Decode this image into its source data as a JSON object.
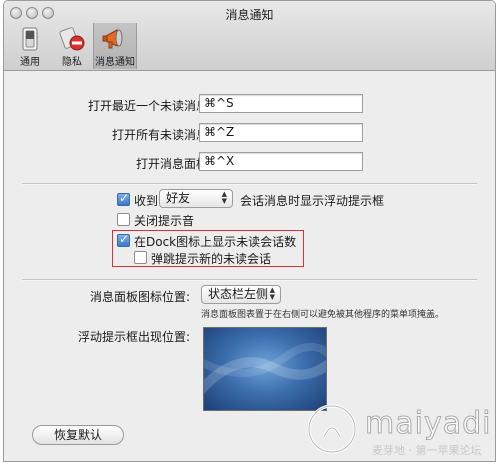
{
  "window": {
    "title": "消息通知"
  },
  "toolbar": {
    "items": [
      {
        "label": "通用",
        "icon": "switch-icon"
      },
      {
        "label": "隐私",
        "icon": "no-entry-icon"
      },
      {
        "label": "消息通知",
        "icon": "megaphone-icon",
        "selected": true
      }
    ]
  },
  "shortcuts": {
    "open_recent_unread": {
      "label": "打开最近一个未读消息:",
      "value": "⌘^S"
    },
    "open_all_unread": {
      "label": "打开所有未读消息:",
      "value": "⌘^Z"
    },
    "open_message_panel": {
      "label": "打开消息面板:",
      "value": "⌘^X"
    }
  },
  "options": {
    "receive": {
      "label": "收到",
      "checked": true,
      "popup_value": "好友",
      "suffix": "会话消息时显示浮动提示框"
    },
    "close_sound": {
      "label": "关闭提示音",
      "checked": false
    },
    "dock_badge": {
      "label": "在Dock图标上显示未读会话数",
      "checked": true
    },
    "bounce": {
      "label": "弹跳提示新的未读会话",
      "checked": false
    }
  },
  "panel_icon": {
    "label": "消息面板图标位置:",
    "value": "状态栏左侧",
    "note": "消息面板图表置于在右侧可以避免被其他程序的菜单项掩盖。"
  },
  "float_position": {
    "label": "浮动提示框出现位置:"
  },
  "restore_button": {
    "label": "恢复默认"
  },
  "watermark": {
    "text": "maiyadi",
    "sub": "麦芽地 · 第一苹果论坛"
  },
  "colors": {
    "highlight_box": "#d9322f",
    "checkbox_blue": "#3b78cc",
    "desktop_blue": "#3c6fae"
  }
}
